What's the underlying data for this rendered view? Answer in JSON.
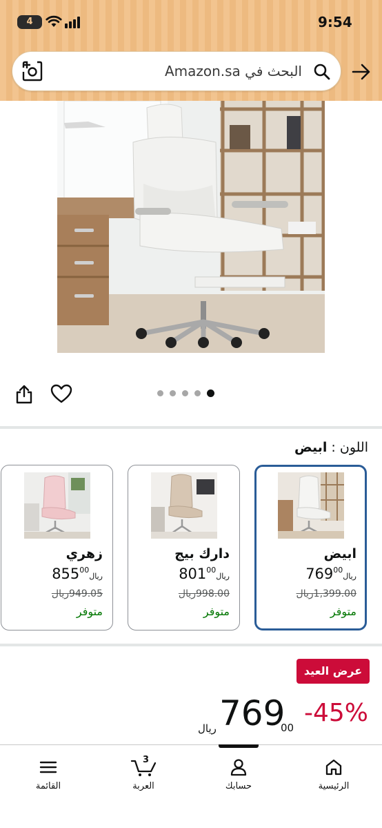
{
  "status": {
    "time": "9:54",
    "battery": "4"
  },
  "search": {
    "placeholder": "البحث في Amazon.sa"
  },
  "color": {
    "label": "اللون :",
    "value": "ابيض"
  },
  "colors": [
    {
      "name": "ابيض",
      "price_whole": "769",
      "price_fraction": "00",
      "currency": "ريال",
      "old_price": "1,399.00ريال",
      "availability": "متوفر",
      "selected": true
    },
    {
      "name": "دارك بيج",
      "price_whole": "801",
      "price_fraction": "00",
      "currency": "ريال",
      "old_price": "998.00ريال",
      "availability": "متوفر",
      "selected": false
    },
    {
      "name": "زهري",
      "price_whole": "855",
      "price_fraction": "00",
      "currency": "ريال",
      "old_price": "949.05ريال",
      "availability": "متوفر",
      "selected": false
    }
  ],
  "deal": {
    "badge": "عرض العيد",
    "discount": "-45%",
    "price_whole": "769",
    "price_fraction": "00",
    "currency": "ريال"
  },
  "nav": [
    {
      "label": "الرئيسية",
      "icon": "home-icon"
    },
    {
      "label": "حسابك",
      "icon": "account-icon"
    },
    {
      "label": "العربة",
      "icon": "cart-icon",
      "count": "3"
    },
    {
      "label": "القائمة",
      "icon": "menu-icon"
    }
  ],
  "gallery": {
    "image_count": 5,
    "active_image": 1
  },
  "colors_theme": {
    "header": "#f2c48f",
    "deal_red": "#cc0c39",
    "in_stock_green": "#007600",
    "selected_border": "#2a5c97"
  }
}
